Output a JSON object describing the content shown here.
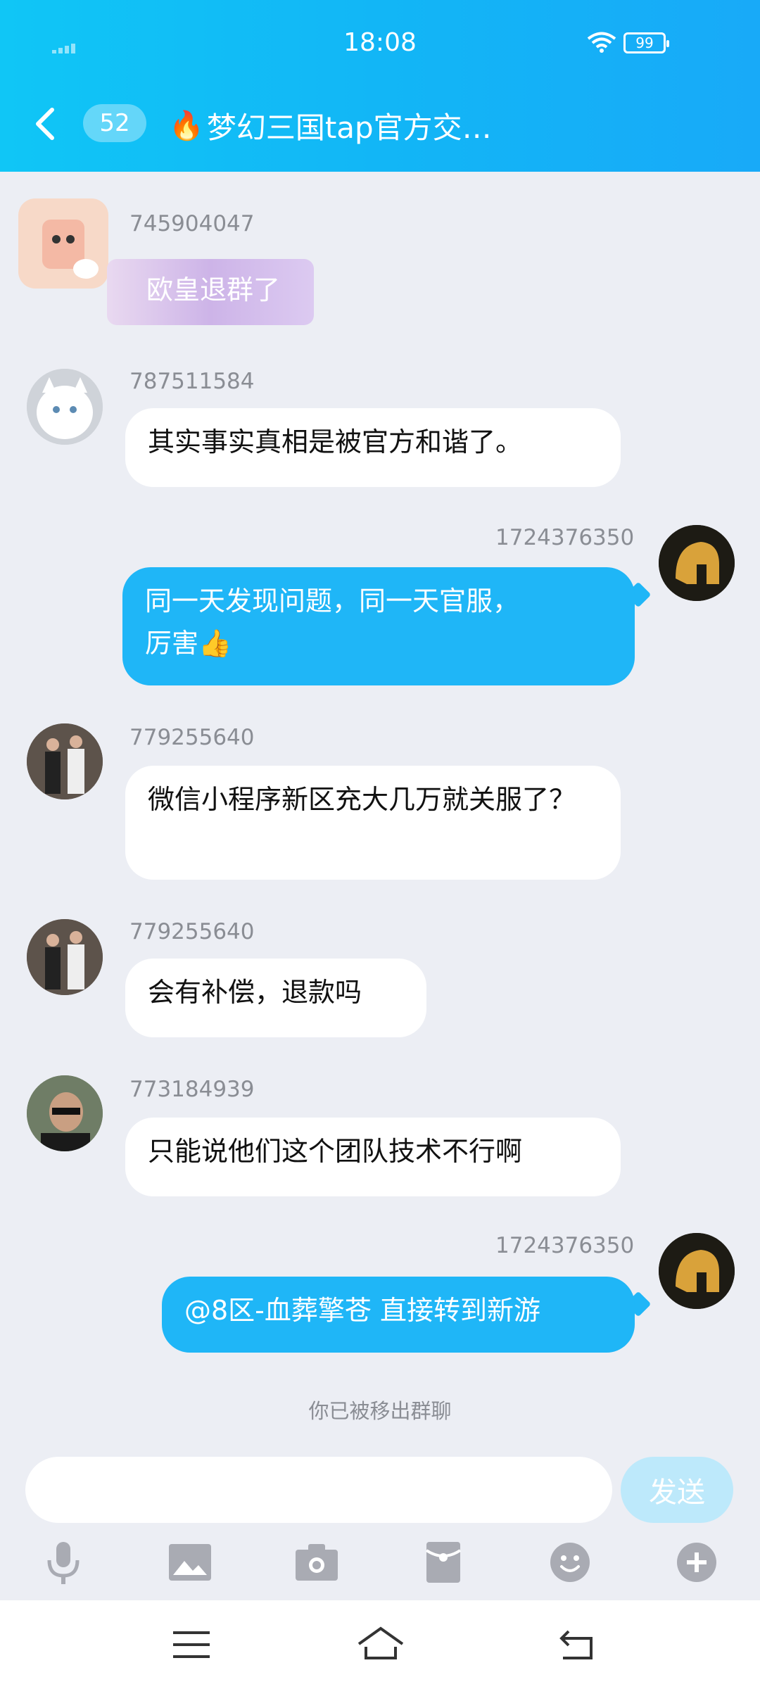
{
  "status_bar": {
    "time": "18:08",
    "battery": "99"
  },
  "nav": {
    "unread_count": "52",
    "title": "梦幻三国tap官方交…"
  },
  "messages": [
    {
      "sender": "745904047",
      "text": "欧皇退群了"
    },
    {
      "sender": "787511584",
      "text": "其实事实真相是被官方和谐了。"
    },
    {
      "sender": "1724376350",
      "text_line1": "同一天发现问题，同一天官服，",
      "text_line2": "厉害👍"
    },
    {
      "sender": "779255640",
      "text": "微信小程序新区充大几万就关服了？"
    },
    {
      "sender": "779255640",
      "text": "会有补偿，退款吗"
    },
    {
      "sender": "773184939",
      "text": "只能说他们这个团队技术不行啊"
    },
    {
      "sender": "1724376350",
      "text": "@8区-血葬擎苍 直接转到新游"
    }
  ],
  "system_notice": "你已被移出群聊",
  "input": {
    "value": "",
    "send_label": "发送"
  },
  "toolbar": [
    "mic-icon",
    "image-icon",
    "camera-icon",
    "red-packet-icon",
    "emoji-icon",
    "plus-icon"
  ],
  "colors": {
    "accent": "#1fb6f7",
    "header_from": "#10c6f6",
    "background": "#eceef4"
  }
}
